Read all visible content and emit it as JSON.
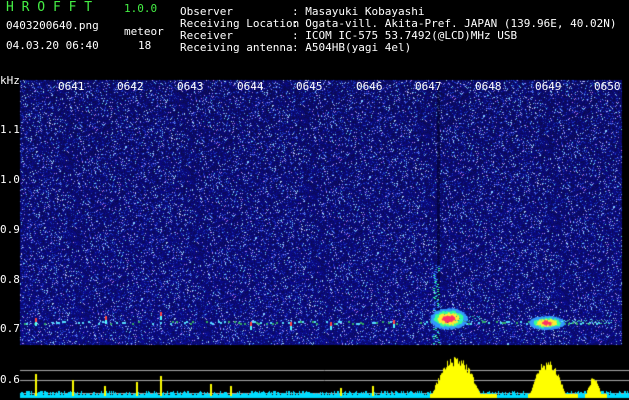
{
  "app": {
    "name": "H R O F F T",
    "version": "1.0.0"
  },
  "file": {
    "name": "0403200640.png",
    "datetime": "04.03.20 06:40"
  },
  "meteor": {
    "label": "meteor",
    "count": "18"
  },
  "info": {
    "observer_label": "Observer",
    "observer_value": ": Masayuki Kobayashi",
    "location_label": "Receiving Location",
    "location_value": ": Ogata-vill. Akita-Pref. JAPAN (139.96E, 40.02N)",
    "receiver_label": "Receiver",
    "receiver_value": ": ICOM IC-575 53.7492(@LCD)MHz USB",
    "antenna_label": "Receiving antenna",
    "antenna_value": ": A504HB(yagi 4el)"
  },
  "axis": {
    "unit": "kHz",
    "time_ticks": [
      "0641",
      "0642",
      "0643",
      "0644",
      "0645",
      "0646",
      "0647",
      "0648",
      "0649",
      "0650"
    ],
    "freq_ticks": [
      "1.1",
      "1.0",
      "0.9",
      "0.8",
      "0.7",
      "0.6"
    ]
  },
  "colors": {
    "background_noise": "#1a1a8c",
    "echo_core": "#ff3366",
    "power_trace": "#ffff00",
    "baseline": "#00ffff",
    "header_green": "#44ee44"
  }
}
